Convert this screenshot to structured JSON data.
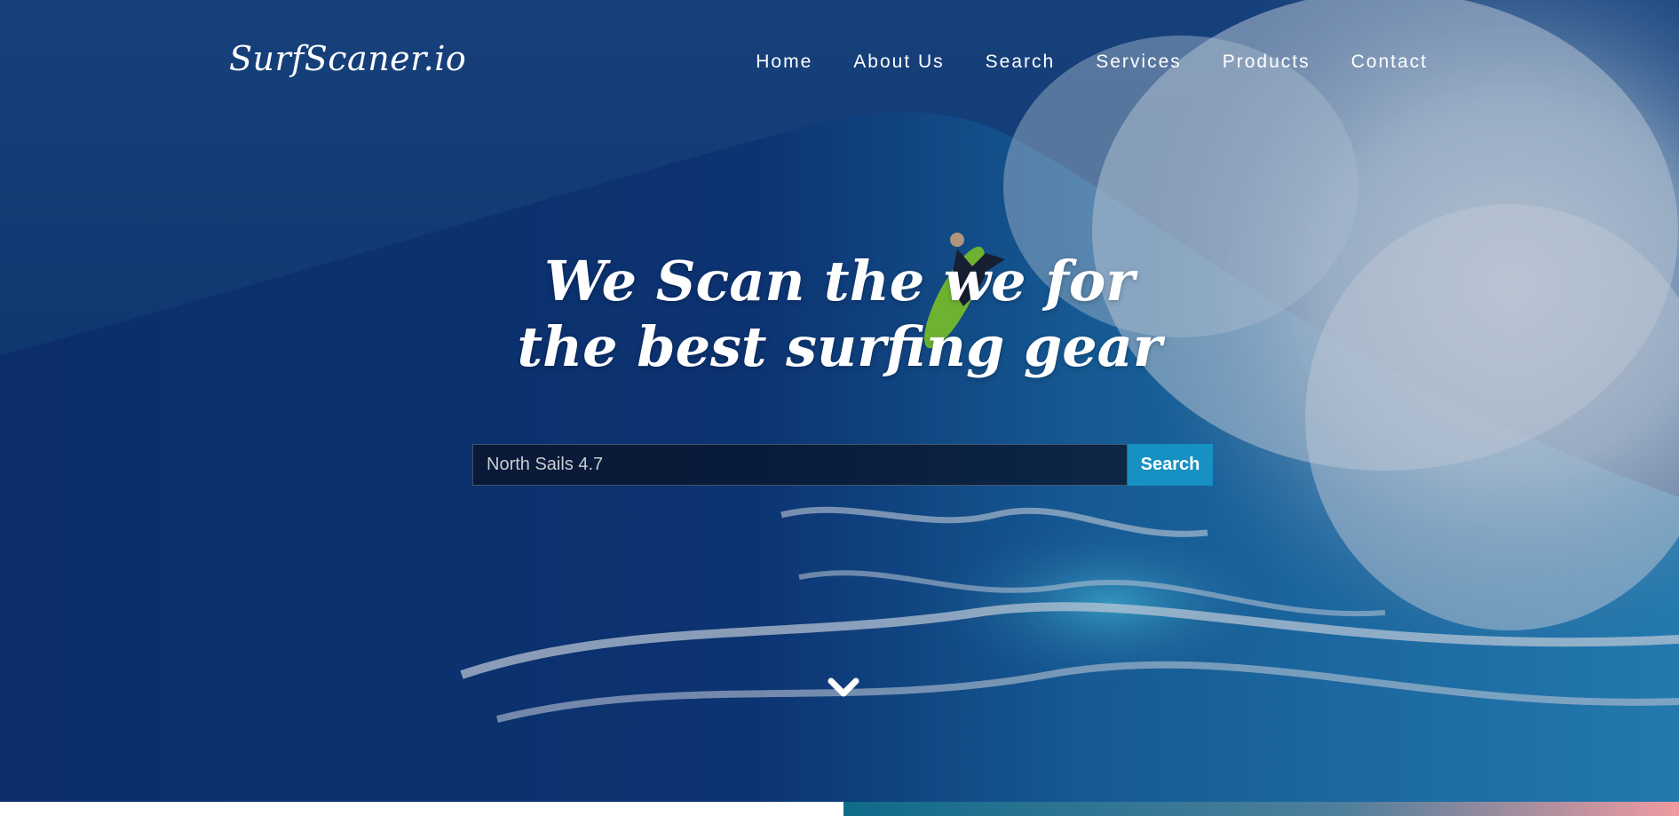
{
  "site": {
    "logo": "SurfScaner.io"
  },
  "nav": {
    "items": [
      {
        "label": "Home"
      },
      {
        "label": "About Us"
      },
      {
        "label": "Search"
      },
      {
        "label": "Services"
      },
      {
        "label": "Products"
      },
      {
        "label": "Contact"
      }
    ]
  },
  "hero": {
    "headline_line1": "We Scan the we for",
    "headline_line2": "the best surfing gear",
    "search": {
      "value": "North Sails 4.7",
      "button_label": "Search"
    },
    "scroll_icon": "chevron-down-icon"
  },
  "colors": {
    "accent": "#1791c3",
    "ocean_dark": "#0c2d5e",
    "text": "#ffffff"
  }
}
